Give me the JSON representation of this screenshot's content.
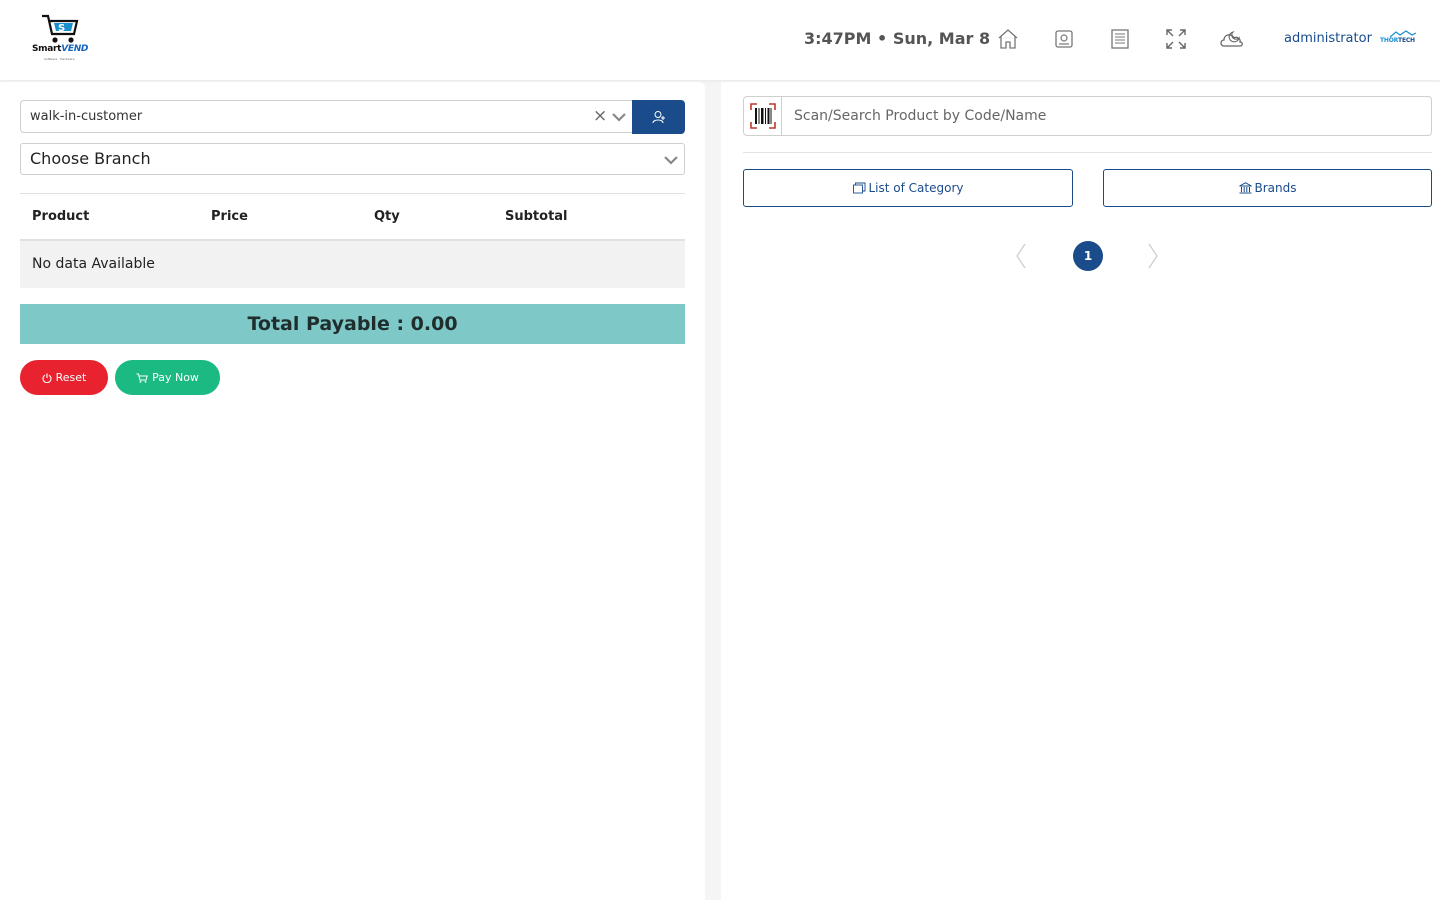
{
  "header": {
    "logo": {
      "brand_main": "Smart",
      "brand_accent": "VEND",
      "tagline": "Software · Hardware"
    },
    "datetime": "3:47PM • Sun, Mar 8",
    "icons": [
      "home-icon",
      "pos-icon",
      "receipt-icon",
      "fullscreen-icon",
      "theme-icon"
    ],
    "user": "administrator",
    "user_logo": {
      "part1": "THOR",
      "part2": "TECH"
    }
  },
  "left": {
    "customer_select": {
      "value": "walk-in-customer",
      "clear_glyph": "×"
    },
    "branch_select": {
      "value": "Choose Branch"
    },
    "table": {
      "columns": [
        "Product",
        "Price",
        "Qty",
        "Subtotal"
      ],
      "empty_text": "No data Available"
    },
    "total_label": "Total Payable : 0.00",
    "buttons": {
      "reset": "Reset",
      "pay": "Pay Now"
    }
  },
  "right": {
    "search": {
      "placeholder": "Scan/Search Product by Code/Name"
    },
    "category_button": "List of Category",
    "brands_button": "Brands",
    "pagination": {
      "current": "1"
    }
  },
  "colors": {
    "primary": "#1a4c8b",
    "total_bar": "#7ec8c8",
    "reset": "#e8232f",
    "pay": "#1bba82"
  }
}
